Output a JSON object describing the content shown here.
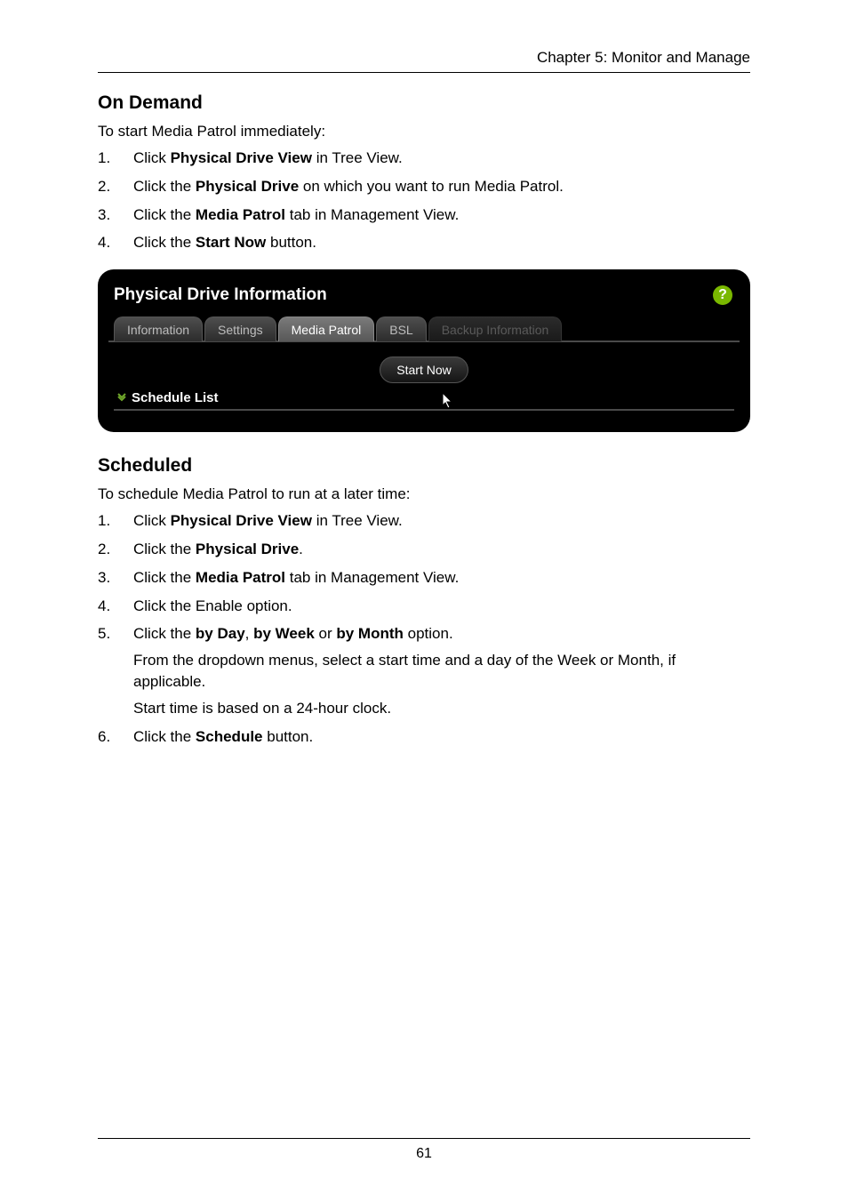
{
  "header": {
    "chapter": "Chapter 5: Monitor and Manage"
  },
  "section1": {
    "title": "On Demand",
    "intro": "To start Media Patrol immediately:",
    "steps": [
      {
        "num": "1.",
        "pre": "Click ",
        "bold": "Physical Drive View",
        "post": " in Tree View."
      },
      {
        "num": "2.",
        "pre": "Click the ",
        "bold": "Physical Drive",
        "post": " on which you want to run Media Patrol."
      },
      {
        "num": "3.",
        "pre": "Click the ",
        "bold": "Media Patrol",
        "post": " tab in Management View."
      },
      {
        "num": "4.",
        "pre": "Click the ",
        "bold": "Start Now",
        "post": " button."
      }
    ]
  },
  "panel": {
    "title": "Physical Drive Information",
    "help_glyph": "?",
    "tabs": [
      {
        "label": "Information",
        "state": "inactive"
      },
      {
        "label": "Settings",
        "state": "inactive"
      },
      {
        "label": "Media Patrol",
        "state": "active"
      },
      {
        "label": "BSL",
        "state": "inactive"
      },
      {
        "label": "Backup Information",
        "state": "disabled"
      }
    ],
    "start_button": "Start Now",
    "schedule_header": "Schedule List"
  },
  "section2": {
    "title": "Scheduled",
    "intro": "To schedule Media Patrol to run at a later time:",
    "steps": [
      {
        "num": "1.",
        "parts": [
          {
            "t": "Click "
          },
          {
            "t": "Physical Drive View",
            "b": true
          },
          {
            "t": " in Tree View."
          }
        ]
      },
      {
        "num": "2.",
        "parts": [
          {
            "t": "Click the "
          },
          {
            "t": "Physical Drive",
            "b": true
          },
          {
            "t": "."
          }
        ]
      },
      {
        "num": "3.",
        "parts": [
          {
            "t": "Click the "
          },
          {
            "t": "Media Patrol",
            "b": true
          },
          {
            "t": " tab in Management View."
          }
        ]
      },
      {
        "num": "4.",
        "parts": [
          {
            "t": "Click the Enable option."
          }
        ]
      },
      {
        "num": "5.",
        "parts": [
          {
            "t": "Click the "
          },
          {
            "t": "by Day",
            "b": true
          },
          {
            "t": ", "
          },
          {
            "t": "by Week",
            "b": true
          },
          {
            "t": " or "
          },
          {
            "t": "by Month",
            "b": true
          },
          {
            "t": " option."
          }
        ],
        "sub": [
          "From the dropdown menus, select a start time and a day of the Week or Month, if applicable.",
          "Start time is based on a 24-hour clock."
        ]
      },
      {
        "num": "6.",
        "parts": [
          {
            "t": "Click the "
          },
          {
            "t": "Schedule",
            "b": true
          },
          {
            "t": " button."
          }
        ]
      }
    ]
  },
  "footer": {
    "page": "61"
  }
}
